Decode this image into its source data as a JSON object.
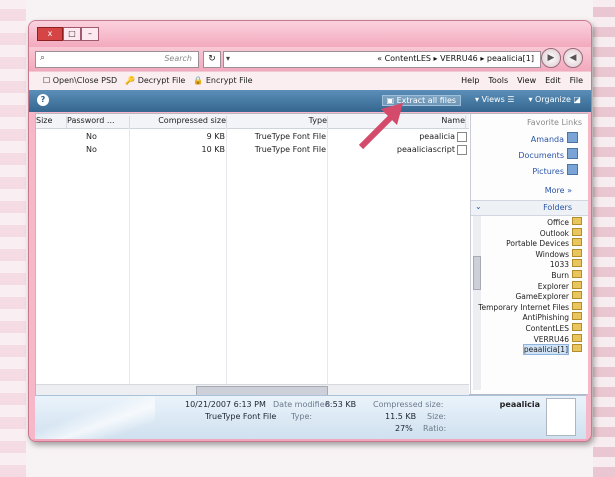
{
  "address": {
    "crumbs": [
      "«",
      "ContentLES",
      "VERRU46",
      "peaalicia[1]"
    ],
    "search_placeholder": "Search"
  },
  "window_buttons": {
    "minimize": "–",
    "maximize": "□",
    "close": "x"
  },
  "menu": {
    "items": [
      "File",
      "Edit",
      "View",
      "Tools",
      "Help"
    ]
  },
  "plugins": [
    {
      "label": "Encrypt File",
      "icon": "lock-icon"
    },
    {
      "label": "Decrypt File",
      "icon": "key-icon"
    },
    {
      "label": "Open\\Close PSD",
      "icon": "folder-icon"
    }
  ],
  "toolbar": {
    "organize": "Organize",
    "views": "Views",
    "extract": "Extract all files",
    "help": "?"
  },
  "columns": [
    "Name",
    "Type",
    "Compressed size",
    "Password ...",
    "Size"
  ],
  "files": [
    {
      "name": "peaalicia",
      "type": "TrueType Font File",
      "compressed": "9 KB",
      "password": "No"
    },
    {
      "name": "peaaliciascript",
      "type": "TrueType Font File",
      "compressed": "10 KB",
      "password": "No"
    }
  ],
  "nav": {
    "favorite_label": "Favorite Links",
    "links": [
      "Amanda",
      "Documents",
      "Pictures"
    ],
    "more": "More »",
    "folders_label": "Folders",
    "tree": [
      "Office",
      "Outlook",
      "Portable Devices",
      "Windows",
      "1033",
      "Burn",
      "Explorer",
      "GameExplorer",
      "Temporary Internet Files",
      "AntiPhishing",
      "ContentLES",
      "VERRU46",
      "peaalicia[1]"
    ],
    "selected": "peaalicia[1]"
  },
  "details": {
    "filename": "peaalicia",
    "compressed_label": "Compressed size:",
    "compressed_value": "8.53 KB",
    "size_label": "Size:",
    "size_value": "11.5 KB",
    "ratio_label": "Ratio:",
    "ratio_value": "27%",
    "modified_label": "Date modified:",
    "modified_value": "10/21/2007 6:13 PM",
    "type_label": "Type:",
    "type_value": "TrueType Font File"
  },
  "colors": {
    "window_frame": "#f6b7c8",
    "toolbar": "#34668f",
    "annotation_arrow": "#d34a6a"
  }
}
